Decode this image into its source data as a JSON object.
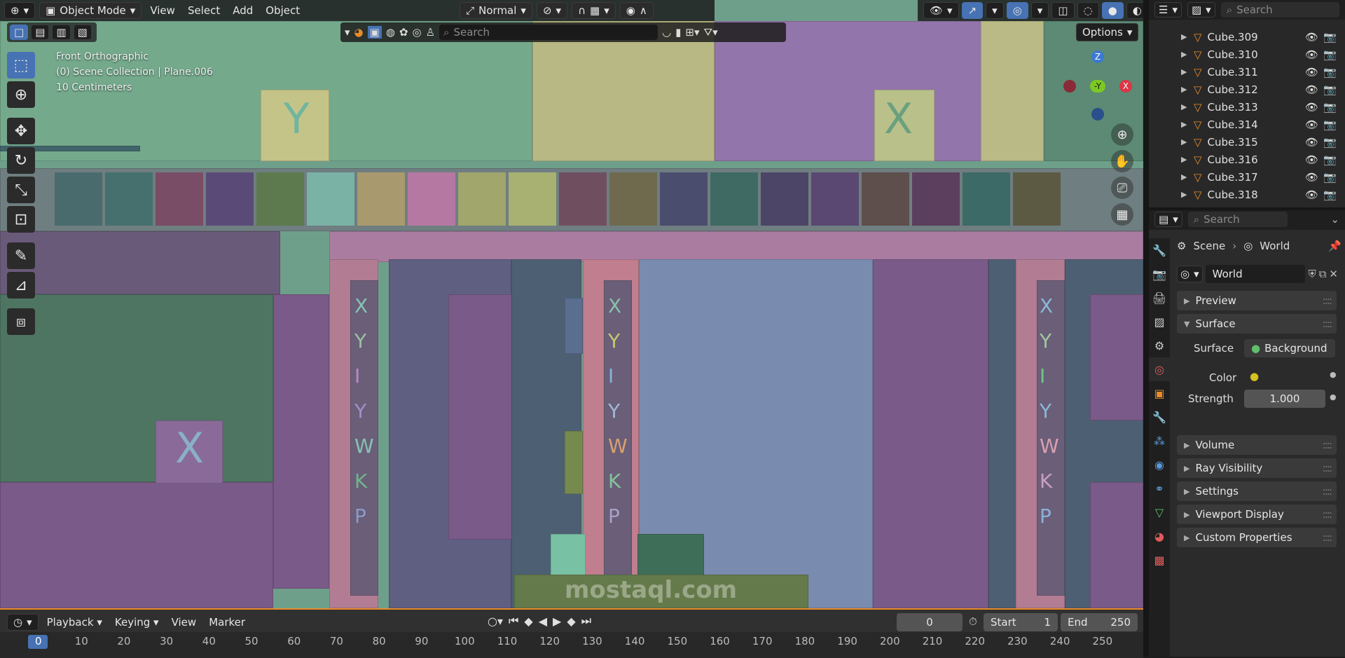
{
  "header": {
    "mode": "Object Mode",
    "menus": [
      "View",
      "Select",
      "Add",
      "Object"
    ],
    "orientation": "Normal",
    "options_label": "Options",
    "search_placeholder": "Search"
  },
  "overlay": {
    "view_name": "Front Orthographic",
    "collection": "(0) Scene Collection | Plane.006",
    "scale": "10 Centimeters"
  },
  "gizmo": {
    "z": "Z",
    "y": "-Y",
    "x": "X"
  },
  "timeline": {
    "menus": [
      "Playback",
      "Keying",
      "View",
      "Marker"
    ],
    "current_frame": "0",
    "start_label": "Start",
    "start_value": "1",
    "end_label": "End",
    "end_value": "250",
    "ruler": [
      "0",
      "10",
      "20",
      "30",
      "40",
      "50",
      "60",
      "70",
      "80",
      "90",
      "100",
      "110",
      "120",
      "130",
      "140",
      "150",
      "160",
      "170",
      "180",
      "190",
      "200",
      "210",
      "220",
      "230",
      "240",
      "250"
    ]
  },
  "outliner": {
    "search_placeholder": "Search",
    "items": [
      "Cube.309",
      "Cube.310",
      "Cube.311",
      "Cube.312",
      "Cube.313",
      "Cube.314",
      "Cube.315",
      "Cube.316",
      "Cube.317",
      "Cube.318"
    ]
  },
  "properties": {
    "search_placeholder": "Search",
    "breadcrumb_scene": "Scene",
    "breadcrumb_world": "World",
    "world_name": "World",
    "panels": [
      "Preview",
      "Surface",
      "Volume",
      "Ray Visibility",
      "Settings",
      "Viewport Display",
      "Custom Properties"
    ],
    "surface_label": "Surface",
    "surface_value": "Background",
    "color_label": "Color",
    "color_value": "#d4c21e",
    "strength_label": "Strength",
    "strength_value": "1.000"
  },
  "watermark": "mostaql.com"
}
